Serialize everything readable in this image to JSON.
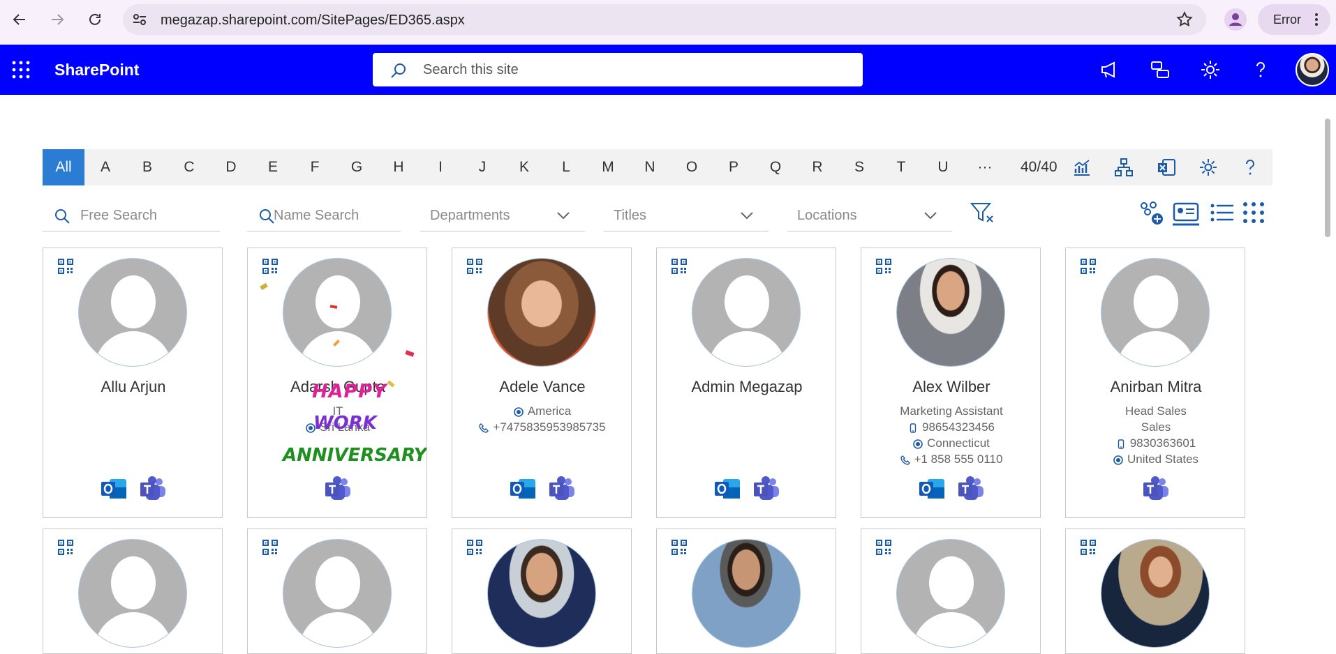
{
  "browser": {
    "url": "megazap.sharepoint.com/SitePages/ED365.aspx",
    "error_label": "Error"
  },
  "sharepoint": {
    "title": "SharePoint",
    "search_placeholder": "Search this site"
  },
  "alphabet": {
    "letters": [
      "All",
      "A",
      "B",
      "C",
      "D",
      "E",
      "F",
      "G",
      "H",
      "I",
      "J",
      "K",
      "L",
      "M",
      "N",
      "O",
      "P",
      "Q",
      "R",
      "S",
      "T",
      "U",
      "···"
    ],
    "active": "All",
    "count": "40/40"
  },
  "filters": {
    "free_search": "Free Search",
    "name_search": "Name Search",
    "departments": "Departments",
    "titles": "Titles",
    "locations": "Locations"
  },
  "cards_row1": [
    {
      "name": "Allu Arjun",
      "lines": [],
      "apps": [
        "outlook",
        "teams"
      ],
      "photo": "placeholder"
    },
    {
      "name": "Adarsh Gupta",
      "lines": [
        {
          "text": "IT",
          "icon": ""
        },
        {
          "text": "Sri Lanka",
          "icon": "location"
        }
      ],
      "apps": [
        "teams"
      ],
      "photo": "placeholder",
      "banner": [
        "HAPPY",
        "WORK",
        "ANNIVERSARY"
      ]
    },
    {
      "name": "Adele Vance",
      "lines": [
        {
          "text": "America",
          "icon": "location"
        },
        {
          "text": "+7475835953985735",
          "icon": "phone"
        }
      ],
      "apps": [
        "outlook",
        "teams"
      ],
      "photo": "woman"
    },
    {
      "name": "Admin Megazap",
      "lines": [],
      "apps": [
        "outlook",
        "teams"
      ],
      "photo": "placeholder"
    },
    {
      "name": "Alex Wilber",
      "lines": [
        {
          "text": "Marketing Assistant",
          "icon": ""
        },
        {
          "text": "98654323456",
          "icon": "mobile"
        },
        {
          "text": "Connecticut",
          "icon": "location"
        },
        {
          "text": "+1 858 555 0110",
          "icon": "phone"
        }
      ],
      "apps": [
        "outlook",
        "teams"
      ],
      "photo": "man"
    },
    {
      "name": "Anirban Mitra",
      "lines": [
        {
          "text": "Head Sales",
          "icon": ""
        },
        {
          "text": "Sales",
          "icon": ""
        },
        {
          "text": "9830363601",
          "icon": "mobile"
        },
        {
          "text": "United States",
          "icon": "location"
        }
      ],
      "apps": [
        "teams"
      ],
      "photo": "placeholder"
    }
  ],
  "cards_row2": [
    {
      "photo": "placeholder"
    },
    {
      "photo": "placeholder"
    },
    {
      "photo": "man-suit"
    },
    {
      "photo": "man-sunglasses"
    },
    {
      "photo": "placeholder"
    },
    {
      "photo": "woman-street"
    }
  ],
  "colors": {
    "sp_bar": "#0000ff",
    "accent": "#2b7cd3",
    "icon_blue": "#1a5aa6"
  }
}
